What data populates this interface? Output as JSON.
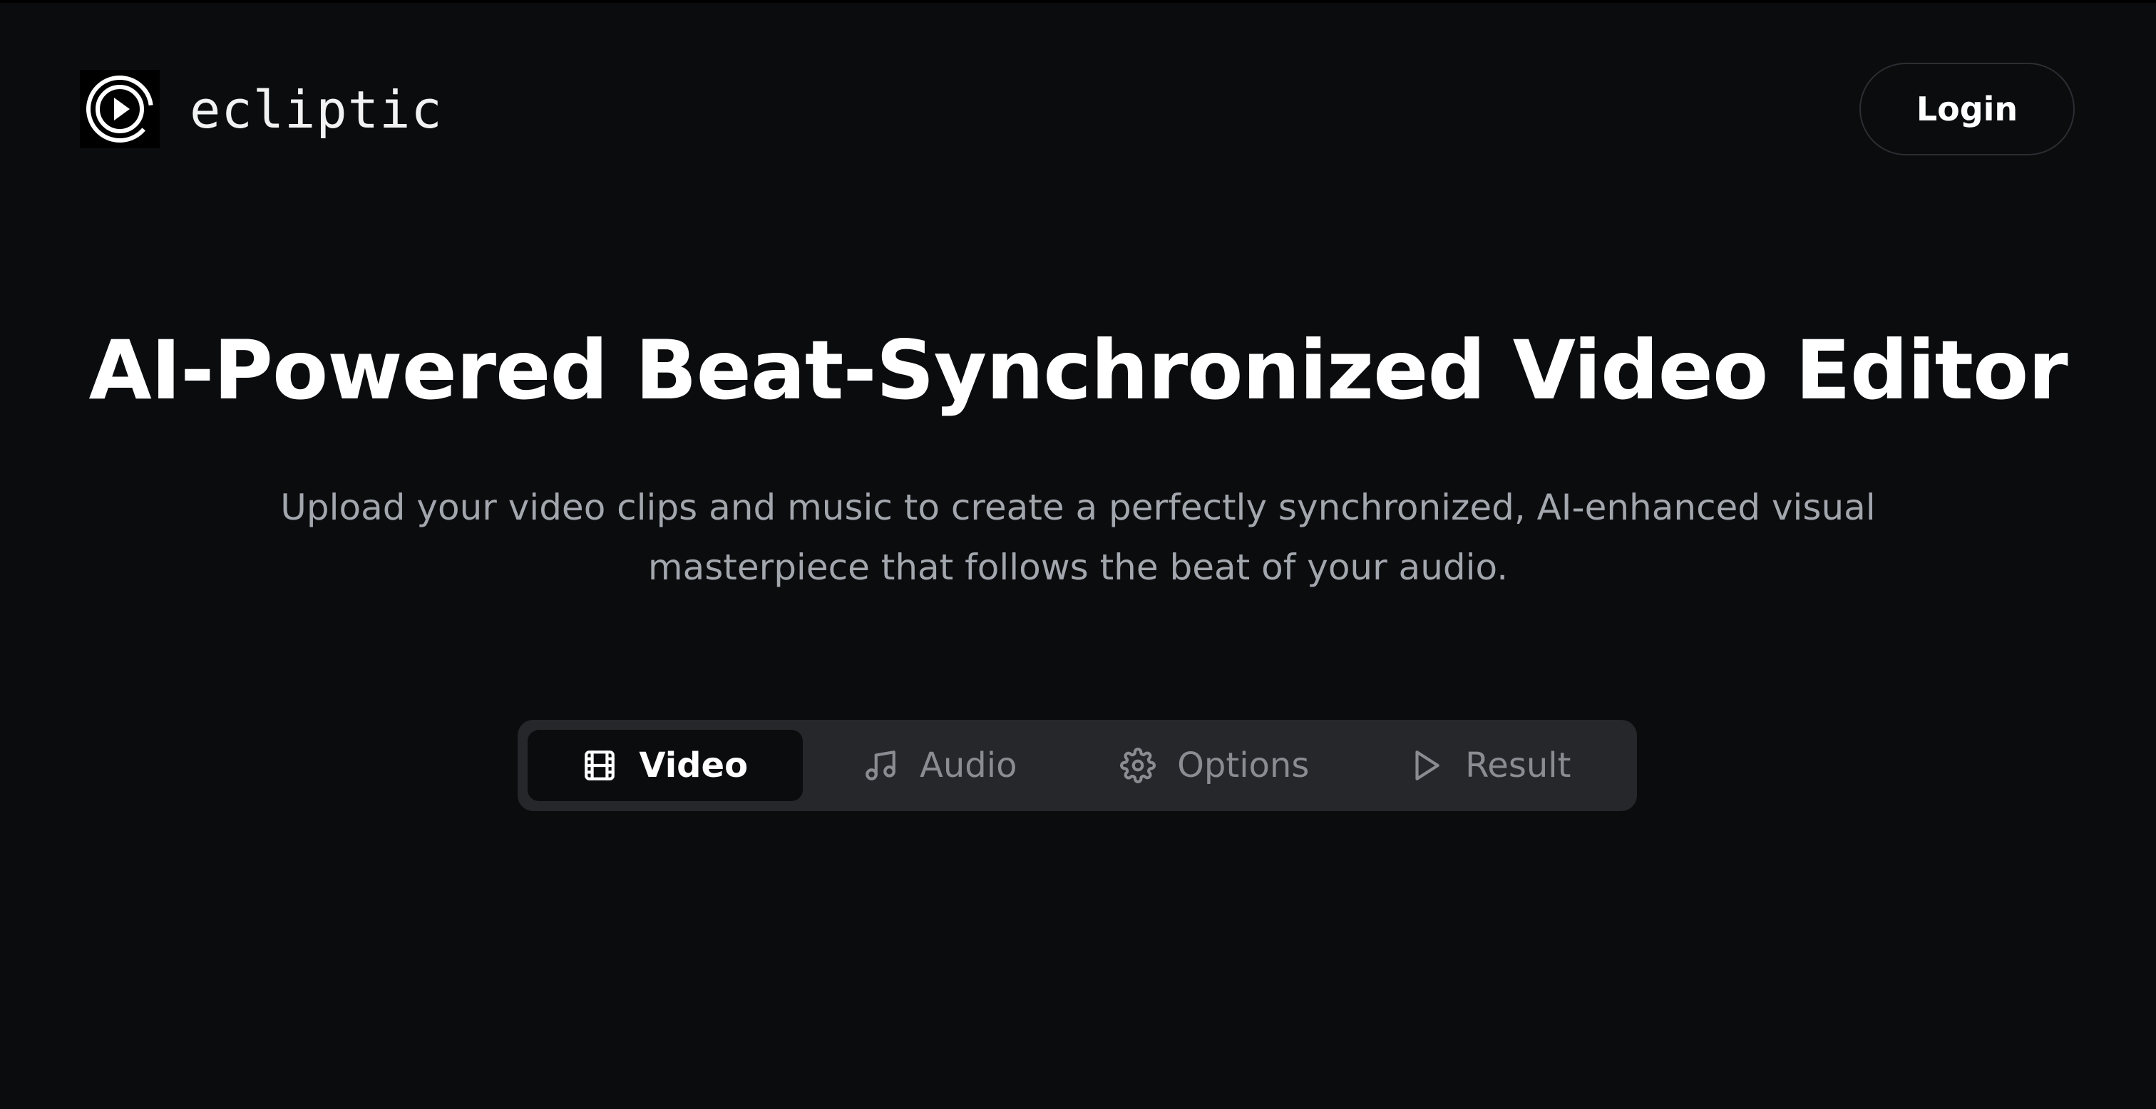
{
  "header": {
    "brand": "ecliptic",
    "logo_icon": "play-circle-icon",
    "login_label": "Login"
  },
  "hero": {
    "title": "AI-Powered Beat-Synchronized Video Editor",
    "subtitle": "Upload your video clips and music to create a perfectly synchronized, AI-enhanced visual masterpiece that follows the beat of your audio."
  },
  "tabs": [
    {
      "label": "Video",
      "icon": "film-icon",
      "active": true
    },
    {
      "label": "Audio",
      "icon": "music-note-icon",
      "active": false
    },
    {
      "label": "Options",
      "icon": "gear-icon",
      "active": false
    },
    {
      "label": "Result",
      "icon": "play-icon",
      "active": false
    }
  ],
  "colors": {
    "background": "#0b0c0e",
    "tab_bar": "#26272b",
    "text_primary": "#ffffff",
    "text_muted": "#a2a6ad",
    "tab_inactive": "#8a8c92"
  }
}
